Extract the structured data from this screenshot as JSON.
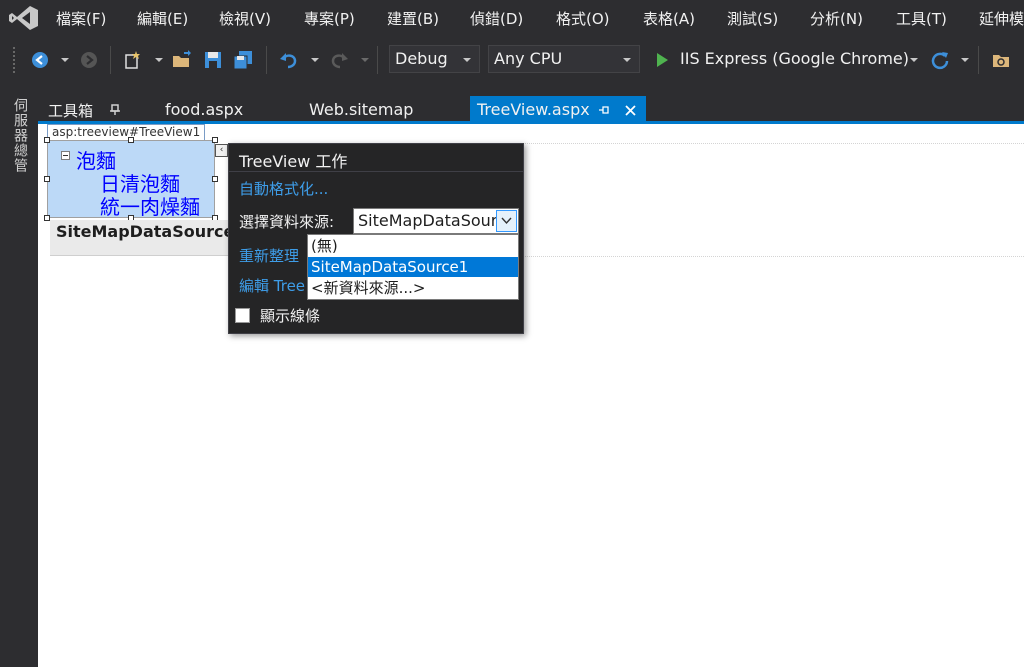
{
  "menu": [
    "檔案(F)",
    "編輯(E)",
    "檢視(V)",
    "專案(P)",
    "建置(B)",
    "偵錯(D)",
    "格式(O)",
    "表格(A)",
    "測試(S)",
    "分析(N)",
    "工具(T)",
    "延伸模"
  ],
  "toolbar": {
    "config": "Debug",
    "platform": "Any CPU",
    "run_target": "IIS Express (Google Chrome)"
  },
  "left_strip": {
    "server_explorer": "伺服器總管"
  },
  "toolbox": {
    "title": "工具箱"
  },
  "tabs": [
    {
      "label": "food.aspx"
    },
    {
      "label": "Web.sitemap"
    },
    {
      "label": "TreeView.aspx",
      "active": true
    }
  ],
  "designer": {
    "treeview_tag": "asp:treeview#TreeView1",
    "tree": {
      "root": "泡麵",
      "children": [
        "日清泡麵",
        "統一肉燥麵"
      ]
    },
    "sitemap_source": "SiteMapDataSource -"
  },
  "tasks_panel": {
    "title": "TreeView 工作",
    "auto_format": "自動格式化...",
    "choose_ds_label": "選擇資料來源:",
    "choose_ds_value": "SiteMapDataSour",
    "refresh_schema": "重新整理",
    "edit_nodes": "編輯 Tree",
    "show_lines": "顯示線條",
    "dropdown_options": [
      "(無)",
      "SiteMapDataSource1",
      "<新資料來源...>"
    ],
    "selected_index": 1
  },
  "colors": {
    "accent": "#007acc",
    "link": "#3e9de8",
    "node": "#0000ff",
    "selection": "#0078d7"
  }
}
